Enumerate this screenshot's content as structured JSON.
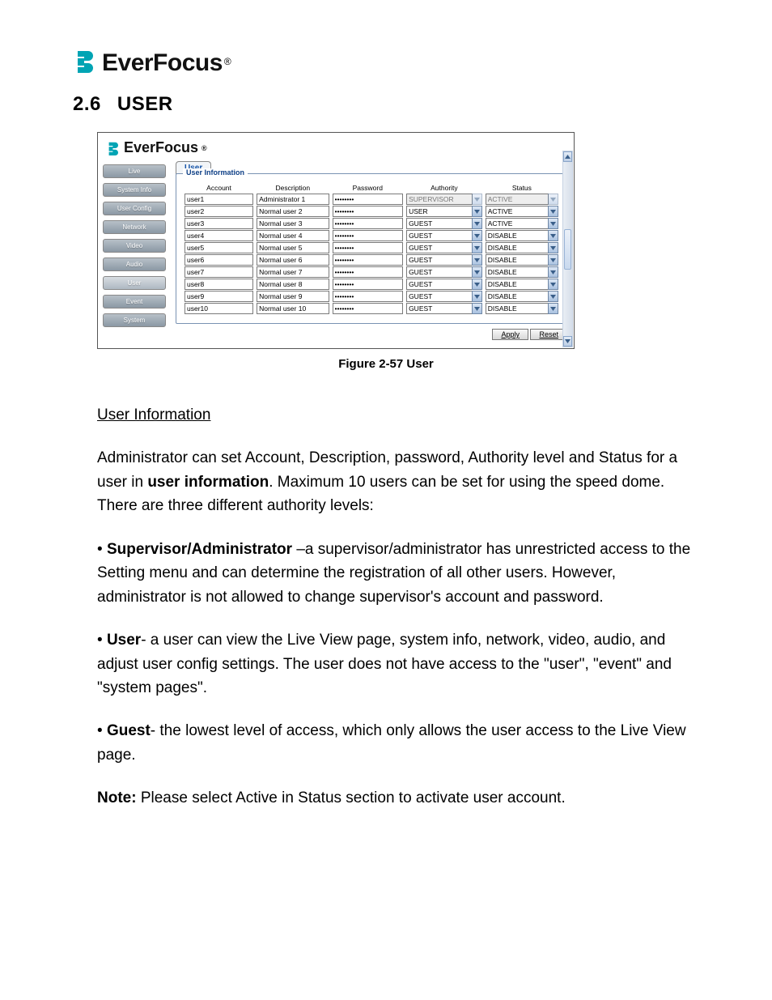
{
  "brand": {
    "name": "EverFocus",
    "reg": "®"
  },
  "section": {
    "num": "2.6",
    "title": "USER"
  },
  "figure": {
    "caption": "Figure 2-57 User"
  },
  "shot": {
    "brand": "EverFocus",
    "sidebar": [
      "Live",
      "System Info",
      "User Config",
      "Network",
      "Video",
      "Audio",
      "User",
      "Event",
      "System"
    ],
    "sidebar_selected_index": 6,
    "tab": "User",
    "fieldset_legend": "User Information",
    "headers": {
      "account": "Account",
      "description": "Description",
      "password": "Password",
      "authority": "Authority",
      "status": "Status"
    },
    "rows": [
      {
        "account": "user1",
        "description": "Administrator 1",
        "password": "••••••••",
        "authority": "SUPERVISOR",
        "status": "ACTIVE",
        "locked": true
      },
      {
        "account": "user2",
        "description": "Normal user 2",
        "password": "••••••••",
        "authority": "USER",
        "status": "ACTIVE",
        "locked": false
      },
      {
        "account": "user3",
        "description": "Normal user 3",
        "password": "••••••••",
        "authority": "GUEST",
        "status": "ACTIVE",
        "locked": false
      },
      {
        "account": "user4",
        "description": "Normal user 4",
        "password": "••••••••",
        "authority": "GUEST",
        "status": "DISABLE",
        "locked": false
      },
      {
        "account": "user5",
        "description": "Normal user 5",
        "password": "••••••••",
        "authority": "GUEST",
        "status": "DISABLE",
        "locked": false
      },
      {
        "account": "user6",
        "description": "Normal user 6",
        "password": "••••••••",
        "authority": "GUEST",
        "status": "DISABLE",
        "locked": false
      },
      {
        "account": "user7",
        "description": "Normal user 7",
        "password": "••••••••",
        "authority": "GUEST",
        "status": "DISABLE",
        "locked": false
      },
      {
        "account": "user8",
        "description": "Normal user 8",
        "password": "••••••••",
        "authority": "GUEST",
        "status": "DISABLE",
        "locked": false
      },
      {
        "account": "user9",
        "description": "Normal user 9",
        "password": "••••••••",
        "authority": "GUEST",
        "status": "DISABLE",
        "locked": false
      },
      {
        "account": "user10",
        "description": "Normal user 10",
        "password": "••••••••",
        "authority": "GUEST",
        "status": "DISABLE",
        "locked": false
      }
    ],
    "buttons": {
      "apply": "Apply",
      "reset": "Reset"
    }
  },
  "text": {
    "h": "User Information",
    "p1a": "Administrator can set Account, Description, password, Authority level and Status for a user in ",
    "p1b": "user information",
    "p1c": ". Maximum 10 users can be set for using the speed dome. There are three different authority levels:",
    "p2a": "• ",
    "p2b": "Supervisor/Administrator",
    "p2c": " –a supervisor/administrator has unrestricted access to the Setting menu and can determine the registration of all other users. However, administrator is not allowed to change supervisor's account and password.",
    "p3a": "• ",
    "p3b": "User",
    "p3c": "- a user can view the Live View page, system info, network, video, audio, and adjust user config settings. The user does not have access to the \"user\", \"event\" and \"system pages\".",
    "p4a": "• ",
    "p4b": "Guest",
    "p4c": "- the lowest level of access, which only allows the user access to the Live View page.",
    "p5a": "Note:",
    "p5b": " Please select Active in Status section to activate user account."
  }
}
